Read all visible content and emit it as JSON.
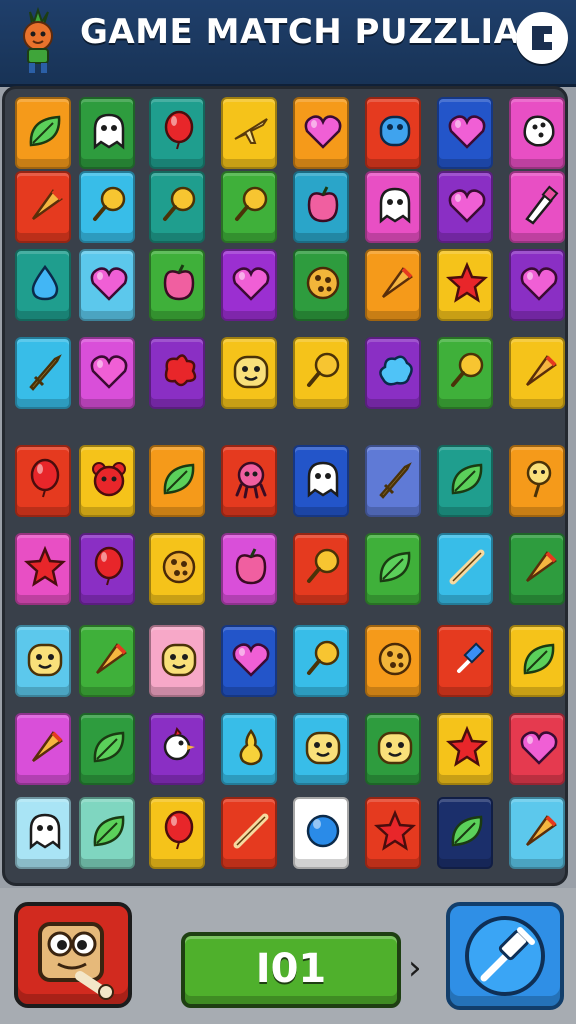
{
  "header": {
    "title": "GAME MATCH PUZZLIA",
    "mascot_icon": "carrot-character-icon",
    "exit_icon": "exit-door-icon"
  },
  "board": {
    "columns": 8,
    "rows": 9,
    "tiles": [
      [
        {
          "color": "#f59a1a",
          "icon": "leaf"
        },
        {
          "color": "#2e9c3e",
          "icon": "ghost"
        },
        {
          "color": "#1f9e8e",
          "icon": "balloon"
        },
        {
          "color": "#f5c31a",
          "icon": "plane"
        },
        {
          "color": "#f59a1a",
          "icon": "heart"
        },
        {
          "color": "#e53a1f",
          "icon": "blob"
        },
        {
          "color": "#2355c9",
          "icon": "heart"
        },
        {
          "color": "#e84fc4",
          "icon": "dice"
        }
      ],
      [
        {
          "color": "#e53a1f",
          "icon": "cone"
        },
        {
          "color": "#38bde8",
          "icon": "lollipop"
        },
        {
          "color": "#1f9e8e",
          "icon": "lollipop"
        },
        {
          "color": "#3fb03a",
          "icon": "lollipop"
        },
        {
          "color": "#2aa5c9",
          "icon": "apple"
        },
        {
          "color": "#e84fc4",
          "icon": "ghost"
        },
        {
          "color": "#8a2fc4",
          "icon": "heart"
        },
        {
          "color": "#e84fc4",
          "icon": "tube"
        }
      ],
      [
        {
          "color": "#1f9e8e",
          "icon": "drop"
        },
        {
          "color": "#5cc8ec",
          "icon": "heart"
        },
        {
          "color": "#3fb03a",
          "icon": "apple"
        },
        {
          "color": "#9b2fd1",
          "icon": "heart"
        },
        {
          "color": "#2e9c3e",
          "icon": "cookie"
        },
        {
          "color": "#f59a1a",
          "icon": "cone"
        },
        {
          "color": "#f5c31a",
          "icon": "star"
        },
        {
          "color": "#8a2fc4",
          "icon": "heart"
        }
      ],
      [
        {
          "color": "#38bde8",
          "icon": "sword"
        },
        {
          "color": "#d94fd9",
          "icon": "heart"
        },
        {
          "color": "#8a2fc4",
          "icon": "splat"
        },
        {
          "color": "#f5c31a",
          "icon": "face"
        },
        {
          "color": "#f5c31a",
          "icon": "lollipop"
        },
        {
          "color": "#8a2fc4",
          "icon": "cloud"
        },
        {
          "color": "#3fb03a",
          "icon": "lollipop"
        },
        {
          "color": "#f5c31a",
          "icon": "cone"
        }
      ],
      [
        {
          "color": "#e53a1f",
          "icon": "balloon"
        },
        {
          "color": "#f5c31a",
          "icon": "bear"
        },
        {
          "color": "#f59a1a",
          "icon": "leaf"
        },
        {
          "color": "#e53a1f",
          "icon": "octopus"
        },
        {
          "color": "#2355c9",
          "icon": "ghost"
        },
        {
          "color": "#5f7ad6",
          "icon": "sword"
        },
        {
          "color": "#1f9e8e",
          "icon": "leaf"
        },
        {
          "color": "#f59a1a",
          "icon": "flower"
        }
      ],
      [
        {
          "color": "#e84fc4",
          "icon": "star"
        },
        {
          "color": "#8a2fc4",
          "icon": "balloon"
        },
        {
          "color": "#f5c31a",
          "icon": "cookie"
        },
        {
          "color": "#d94fd9",
          "icon": "apple"
        },
        {
          "color": "#e53a1f",
          "icon": "lollipop"
        },
        {
          "color": "#3fb03a",
          "icon": "leaf"
        },
        {
          "color": "#38bde8",
          "icon": "stick"
        },
        {
          "color": "#2e9c3e",
          "icon": "cone"
        }
      ],
      [
        {
          "color": "#5cc8ec",
          "icon": "face"
        },
        {
          "color": "#3fb03a",
          "icon": "cone"
        },
        {
          "color": "#f7a8c8",
          "icon": "face"
        },
        {
          "color": "#2355c9",
          "icon": "heart"
        },
        {
          "color": "#38bde8",
          "icon": "lollipop"
        },
        {
          "color": "#f59a1a",
          "icon": "cookie"
        },
        {
          "color": "#e53a1f",
          "icon": "pin"
        },
        {
          "color": "#f5c31a",
          "icon": "leaf"
        }
      ],
      [
        {
          "color": "#d94fd9",
          "icon": "cone"
        },
        {
          "color": "#2e9c3e",
          "icon": "leaf"
        },
        {
          "color": "#8a2fc4",
          "icon": "chicken"
        },
        {
          "color": "#38bde8",
          "icon": "pear"
        },
        {
          "color": "#38bde8",
          "icon": "face"
        },
        {
          "color": "#2e9c3e",
          "icon": "face"
        },
        {
          "color": "#f5c31a",
          "icon": "star"
        },
        {
          "color": "#e53a4f",
          "icon": "heart"
        }
      ],
      [
        {
          "color": "#a9e4f5",
          "icon": "ghost"
        },
        {
          "color": "#7fd6c0",
          "icon": "leaf"
        },
        {
          "color": "#f5c31a",
          "icon": "balloon"
        },
        {
          "color": "#e53a1f",
          "icon": "stick"
        },
        {
          "color": "#ffffff",
          "icon": "ball"
        },
        {
          "color": "#e53a1f",
          "icon": "star"
        },
        {
          "color": "#1b2f6b",
          "icon": "leaf"
        },
        {
          "color": "#5cc8ec",
          "icon": "cone"
        }
      ]
    ]
  },
  "bottom_bar": {
    "hint_icon": "bone-character-icon",
    "score": "I01",
    "next_icon": "chevron-right-icon",
    "tool_icon": "pin-tool-icon"
  },
  "colors": {
    "header_bg": "#1f3f6b",
    "board_bg": "#39404a",
    "hint_button": "#d22a1f",
    "score_box": "#4fb02c",
    "tool_button": "#2f8fe6"
  }
}
